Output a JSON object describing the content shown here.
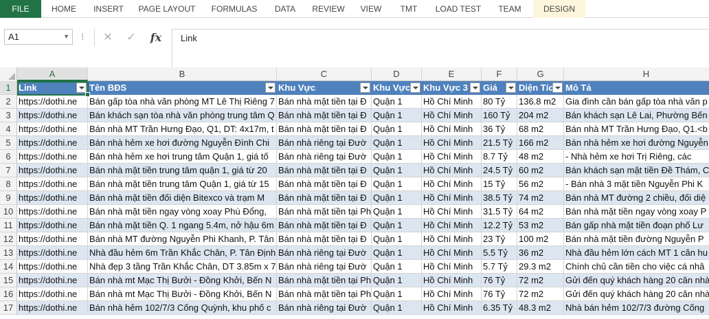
{
  "ribbon": {
    "tabs": [
      {
        "label": "FILE"
      },
      {
        "label": "HOME"
      },
      {
        "label": "INSERT"
      },
      {
        "label": "PAGE LAYOUT"
      },
      {
        "label": "FORMULAS"
      },
      {
        "label": "DATA"
      },
      {
        "label": "REVIEW"
      },
      {
        "label": "VIEW"
      },
      {
        "label": "TMT"
      },
      {
        "label": "LOAD TEST"
      },
      {
        "label": "TEAM"
      },
      {
        "label": "DESIGN"
      }
    ]
  },
  "formula_bar": {
    "name_box": "A1",
    "cancel_icon": "✕",
    "enter_icon": "✓",
    "fx_label": "fx",
    "value": "Link"
  },
  "colors": {
    "header_fill": "#4f81bd",
    "band_fill": "#dce6f1",
    "excel_green": "#217346"
  },
  "columns": [
    "A",
    "B",
    "C",
    "D",
    "E",
    "F",
    "G",
    "H"
  ],
  "headers": [
    "Link",
    "Tên BĐS",
    "Khu Vực",
    "Khu Vực",
    "Khu Vực 3",
    "Giá",
    "Diện Tíc",
    "Mô Tả"
  ],
  "rows": [
    {
      "num": "2",
      "cells": [
        "https://dothi.ne",
        "Bán gấp tòa nhà văn phòng MT Lê Thị Riêng 7",
        "Bán nhà mặt tiền tại Đ",
        "Quận 1",
        "Hồ Chí Minh",
        "80 Tỷ",
        "136.8 m2",
        "Gia đình cần bán gấp tòa nhà văn p"
      ]
    },
    {
      "num": "3",
      "cells": [
        "https://dothi.ne",
        "Bán khách sạn tòa nhà văn phòng trung tâm Q",
        "Bán nhà mặt tiền tại Đ",
        "Quận 1",
        "Hồ Chí Minh",
        "160 Tỷ",
        "204 m2",
        "Bán khách sạn Lê Lai, Phường Bến"
      ]
    },
    {
      "num": "4",
      "cells": [
        "https://dothi.ne",
        "Bán nhà MT Trần Hưng Đạo, Q1, DT: 4x17m, t",
        "Bán nhà mặt tiền tại Đ",
        "Quận 1",
        "Hồ Chí Minh",
        "36 Tỷ",
        "68 m2",
        "Bán nhà MT Trần Hưng Đạo, Q1.<b"
      ]
    },
    {
      "num": "5",
      "cells": [
        "https://dothi.ne",
        "Bán nhà hẻm xe hơi đường Nguyễn Đình Chi",
        "Bán nhà riêng tại Đườ",
        "Quận 1",
        "Hồ Chí Minh",
        "21.5 Tỷ",
        "166 m2",
        "Bán nhà hẻm xe hơi đường Nguyễn"
      ]
    },
    {
      "num": "6",
      "cells": [
        "https://dothi.ne",
        "Bán nhà hẻm xe hơi trung tâm Quận 1, giá tố",
        "Bán nhà riêng tại Đườ",
        "Quận 1",
        "Hồ Chí Minh",
        "8.7 Tỷ",
        "48 m2",
        "- Nhà hẻm xe hơi Trị Riêng, các"
      ]
    },
    {
      "num": "7",
      "cells": [
        "https://dothi.ne",
        "Bán nhà mặt tiền trung tâm quận 1, giá từ 20",
        "Bán nhà mặt tiền tại Đ",
        "Quận 1",
        "Hồ Chí Minh",
        "24.5 Tỷ",
        "60 m2",
        "Bán khách sạn mặt tiền Đề Thám, C"
      ]
    },
    {
      "num": "8",
      "cells": [
        "https://dothi.ne",
        "Bán nhà mặt tiền trung tâm Quận 1, giá từ 15",
        "Bán nhà mặt tiền tại Đ",
        "Quận 1",
        "Hồ Chí Minh",
        "15 Tỷ",
        "56 m2",
        "- Bán nhà 3 mặt tiền Nguyễn Phi K"
      ]
    },
    {
      "num": "9",
      "cells": [
        "https://dothi.ne",
        "Bán nhà mặt tiền đối diện Bitexco và trạm M",
        "Bán nhà mặt tiền tại Đ",
        "Quận 1",
        "Hồ Chí Minh",
        "38.5 Tỷ",
        "74 m2",
        "Bán nhà MT đường 2 chiều, đối diệ"
      ]
    },
    {
      "num": "10",
      "cells": [
        "https://dothi.ne",
        "Bán nhà mặt tiền ngay vòng xoay Phù Đổng, ",
        "Bán nhà mặt tiền tại Ph",
        "Quận 1",
        "Hồ Chí Minh",
        "31.5 Tỷ",
        "64 m2",
        "Bán nhà mặt tiền ngay vòng xoay P"
      ]
    },
    {
      "num": "11",
      "cells": [
        "https://dothi.ne",
        "Bán nhà mặt tiền Q. 1 ngang 5.4m, nở hậu 6m",
        "Bán nhà mặt tiền tại Đ",
        "Quận 1",
        "Hồ Chí Minh",
        "12.2 Tỷ",
        "53 m2",
        "Bán gấp nhà mặt tiền đoạn phố Lư"
      ]
    },
    {
      "num": "12",
      "cells": [
        "https://dothi.ne",
        "Bán nhà MT đường Nguyễn Phi Khanh, P. Tân",
        "Bán nhà mặt tiền tại Đ",
        "Quận 1",
        "Hồ Chí Minh",
        "23 Tỷ",
        "100 m2",
        "Bán nhà mặt tiền đường Nguyễn P"
      ]
    },
    {
      "num": "13",
      "cells": [
        "https://dothi.ne",
        "Nhà đầu hẻm 6m Trần Khắc Chân, P. Tân Định",
        "Bán nhà riêng tại Đườ",
        "Quận 1",
        "Hồ Chí Minh",
        "5.5 Tỷ",
        "36 m2",
        "Nhà đầu hẻm lớn cách MT 1 căn hu"
      ]
    },
    {
      "num": "14",
      "cells": [
        "https://dothi.ne",
        "Nhà đẹp 3 tầng Trần Khắc Chân, DT 3.85m x 7",
        "Bán nhà riêng tại Đườ",
        "Quận 1",
        "Hồ Chí Minh",
        "5.7 Tỷ",
        "29.3 m2",
        "Chính chủ cần tiền cho việc cá nhâ"
      ]
    },
    {
      "num": "15",
      "cells": [
        "https://dothi.ne",
        "Bán nhà mt Mạc Thị Bưởi - Đồng Khởi, Bến N",
        "Bán nhà mặt tiền tại Ph",
        "Quận 1",
        "Hồ Chí Minh",
        "76 Tỷ",
        "72 m2",
        "Gửi đến quý khách hàng 20 căn nhà"
      ]
    },
    {
      "num": "16",
      "cells": [
        "https://dothi.ne",
        "Bán nhà mt Mạc Thị Bưởi - Đồng Khởi, Bến N",
        "Bán nhà mặt tiền tại Ph",
        "Quận 1",
        "Hồ Chí Minh",
        "76 Tỷ",
        "72 m2",
        "Gửi đến quý khách hàng 20 căn nhà"
      ]
    },
    {
      "num": "17",
      "cells": [
        "https://dothi.ne",
        "Bán nhà hẻm 102/7/3 Cống Quỳnh, khu phố c",
        "Bán nhà riêng tại Đườ",
        "Quận 1",
        "Hồ Chí Minh",
        "6.35 Tỷ",
        "48.3 m2",
        "Nhà bán hẻm 102/7/3 đường Cống"
      ]
    }
  ]
}
